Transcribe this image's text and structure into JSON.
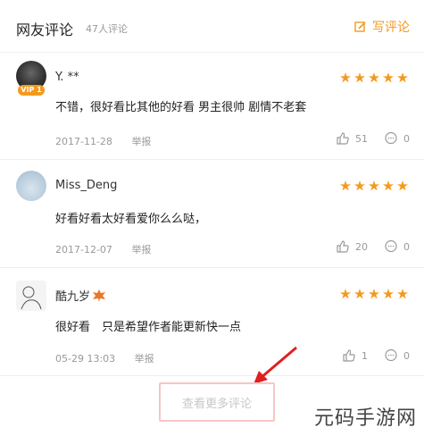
{
  "header": {
    "title": "网友评论",
    "count": "47人评论",
    "write_label": "写评论",
    "accent": "#f39a1e"
  },
  "comments": [
    {
      "name": "Y. **",
      "vip": "VIP 1",
      "rating": 5,
      "text": "不错，很好看比其他的好看 男主很帅 剧情不老套",
      "date": "2017-11-28",
      "report": "举报",
      "likes": "51",
      "replies": "0"
    },
    {
      "name": "Miss_Deng",
      "rating": 5,
      "text": "好看好看太好看爱你么么哒，",
      "date": "2017-12-07",
      "report": "举报",
      "likes": "20",
      "replies": "0"
    },
    {
      "name": "酷九岁",
      "rating": 5,
      "text": "很好看　只是希望作者能更新快一点",
      "date": "05-29 13:03",
      "report": "举报",
      "likes": "1",
      "replies": "0"
    }
  ],
  "more_label": "查看更多评论",
  "watermark": "元码手游网"
}
